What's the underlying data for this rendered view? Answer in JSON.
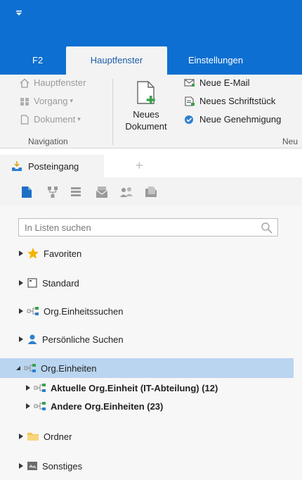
{
  "titlebar": {
    "quick_access_icon": "dropdown-arrow-icon"
  },
  "tabs": [
    {
      "label": "F2",
      "active": false
    },
    {
      "label": "Hauptfenster",
      "active": true
    },
    {
      "label": "Einstellungen",
      "active": false
    }
  ],
  "ribbon": {
    "navigation": {
      "items": [
        {
          "label": "Hauptfenster",
          "icon": "home-icon"
        },
        {
          "label": "Vorgang",
          "icon": "process-icon"
        },
        {
          "label": "Dokument",
          "icon": "document-icon"
        }
      ],
      "group_label": "Navigation"
    },
    "new_group": {
      "big_button": {
        "line1": "Neues",
        "line2": "Dokument",
        "icon": "new-document-icon"
      },
      "items": [
        {
          "label": "Neue E-Mail",
          "icon": "new-mail-icon"
        },
        {
          "label": "Neues Schriftstück",
          "icon": "new-letter-icon"
        },
        {
          "label": "Neue Genehmigung",
          "icon": "approval-icon"
        }
      ],
      "group_label": "Neu"
    }
  },
  "doc_tabs": {
    "active_label": "Posteingang",
    "add": "+"
  },
  "search": {
    "placeholder": "In Listen suchen"
  },
  "tree": {
    "favoriten": "Favoriten",
    "standard": "Standard",
    "org_suchen": "Org.Einheitssuchen",
    "persoenlich": "Persönliche Suchen",
    "org_einheiten": "Org.Einheiten",
    "aktuelle": "Aktuelle Org.Einheit (IT-Abteilung) (12)",
    "andere": "Andere Org.Einheiten (23)",
    "ordner": "Ordner",
    "sonstiges": "Sonstiges"
  },
  "colors": {
    "accent": "#0d6fd1",
    "selection": "#b9d5f0",
    "folder": "#f2c14e",
    "star": "#f5b301"
  }
}
